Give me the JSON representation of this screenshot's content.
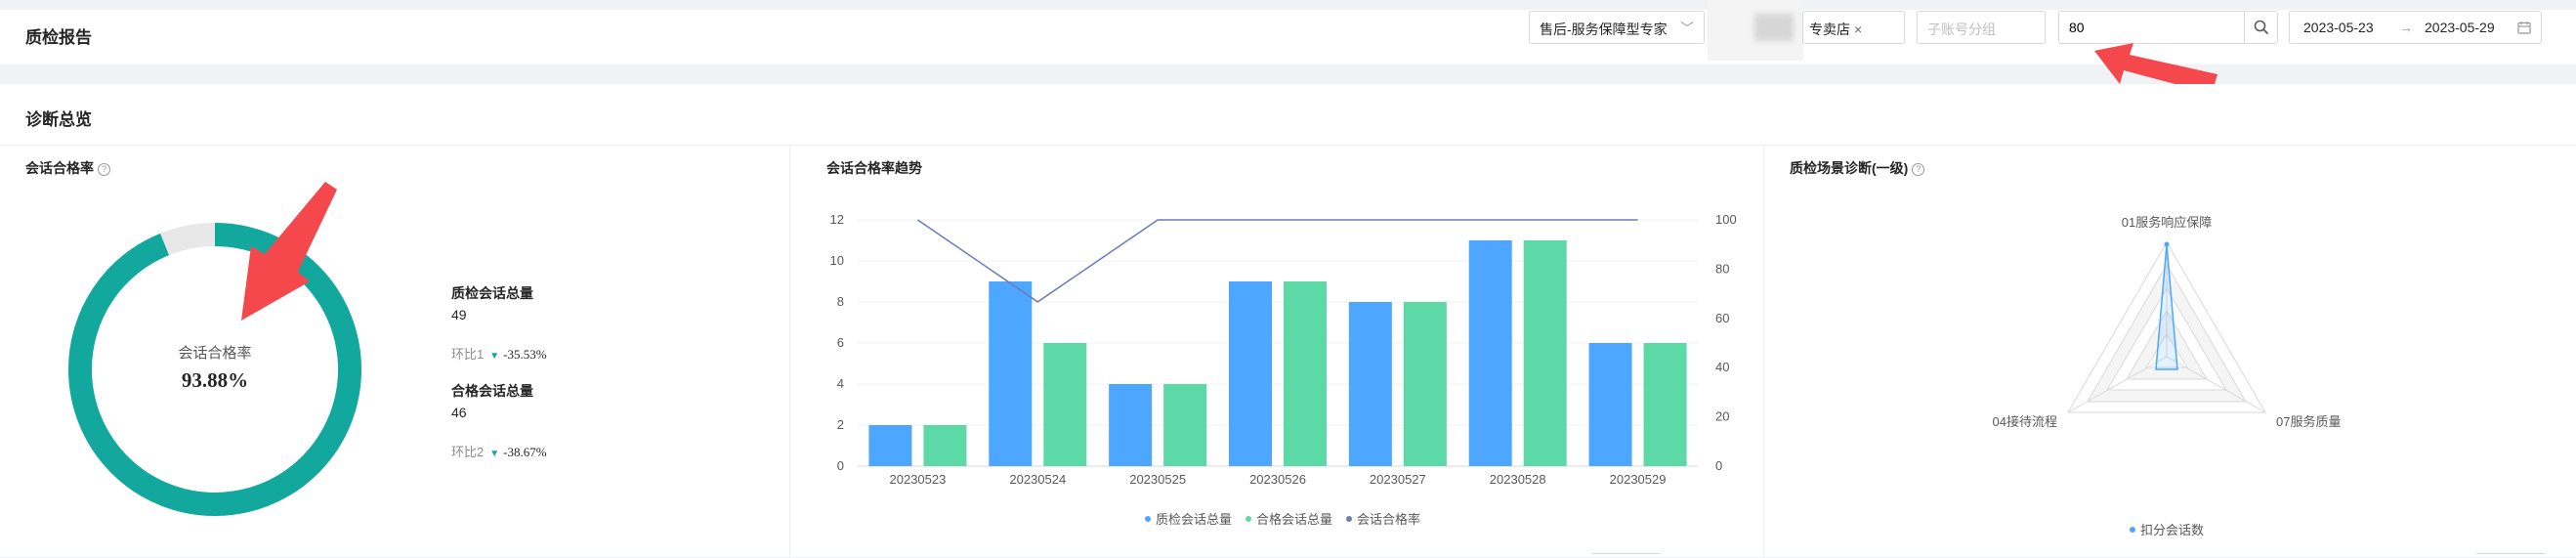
{
  "header": {
    "title": "质检报告",
    "dept_select": "售后-服务保障型专家",
    "shop_tag": "专卖店",
    "sub_account_placeholder": "子账号分组",
    "search_value": "80",
    "date_start": "2023-05-23",
    "date_sep": "→",
    "date_end": "2023-05-29"
  },
  "overview": {
    "title": "诊断总览",
    "pass_rate_card": {
      "title": "会话合格率",
      "center_label": "会话合格率",
      "center_value": "93.88%",
      "ratio": 0.9388,
      "total_label": "质检会话总量",
      "total_value": "49",
      "cmp1_label": "环比1",
      "cmp1_value": "-35.53%",
      "qualified_label": "合格会话总量",
      "qualified_value": "46",
      "cmp2_label": "环比2",
      "cmp2_value": "-38.67%"
    },
    "trend_card": {
      "title": "会话合格率趋势"
    },
    "radar_card": {
      "title": "质检场景诊断(一级)",
      "axes": [
        "01服务响应保障",
        "07服务质量",
        "04接待流程"
      ],
      "legend": "扣分会话数"
    }
  },
  "chart_data": {
    "type": "bar",
    "categories": [
      "20230523",
      "20230524",
      "20230525",
      "20230526",
      "20230527",
      "20230528",
      "20230529"
    ],
    "series": [
      {
        "name": "质检会话总量",
        "kind": "bar",
        "color": "#4da6ff",
        "values": [
          2,
          9,
          4,
          9,
          8,
          11,
          6
        ]
      },
      {
        "name": "合格会话总量",
        "kind": "bar",
        "color": "#5cd9a6",
        "values": [
          2,
          6,
          4,
          9,
          8,
          11,
          6
        ]
      },
      {
        "name": "会话合格率",
        "kind": "line",
        "axis": "right",
        "color": "#6f7bb8",
        "values": [
          100,
          66.7,
          100,
          100,
          100,
          100,
          100
        ]
      }
    ],
    "ylim": [
      0,
      12
    ],
    "yticks": [
      0,
      2,
      4,
      6,
      8,
      10,
      12
    ],
    "y2lim": [
      0,
      100
    ],
    "y2ticks": [
      0,
      20,
      40,
      60,
      80,
      100
    ],
    "grid": true,
    "legend": "bottom"
  },
  "colors": {
    "donut": "#13a89e",
    "donut_track": "#e8e8e8",
    "arrow": "#f5484d",
    "radar_line": "#4da6ff"
  }
}
